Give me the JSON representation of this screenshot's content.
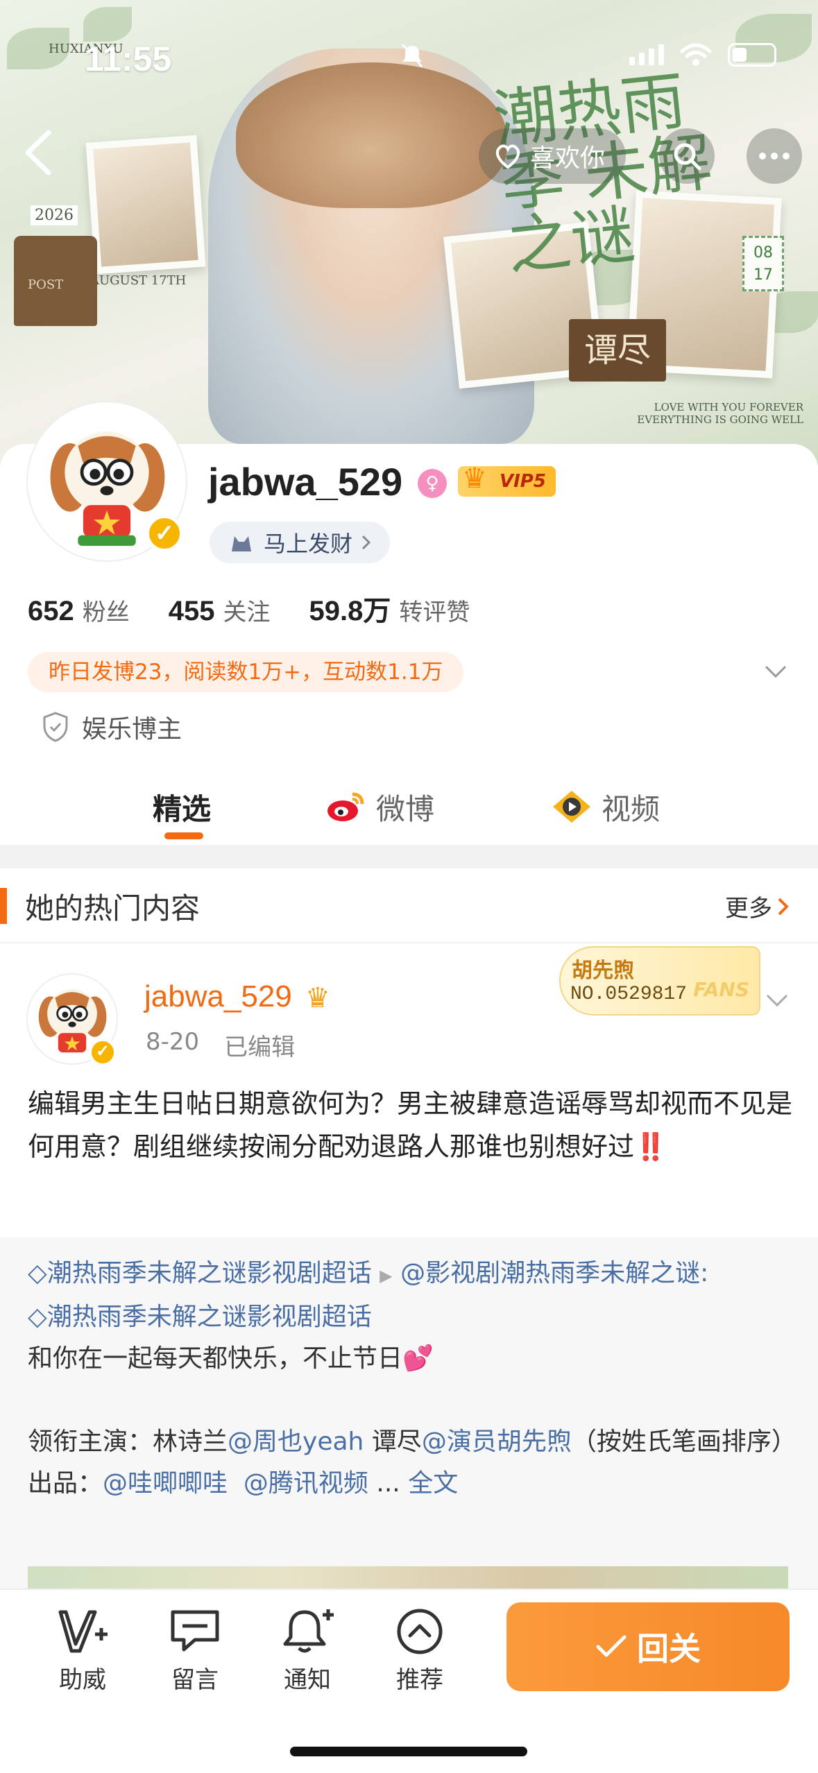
{
  "status_bar": {
    "time": "11:55"
  },
  "cover": {
    "tag_top": "HUXIANXU",
    "tag_year": "2026",
    "tag_date": "AUGUST 17TH",
    "postbox_label": "POST",
    "calligraphy": "潮热雨季 未解之谜",
    "stamp": "08 17",
    "role_badge": "谭尽",
    "tagline": "LOVE WITH YOU FOREVER EVERYTHING IS GOING WELL"
  },
  "nav": {
    "like_label": "喜欢你"
  },
  "profile": {
    "username": "jabwa_529",
    "vip_label": "VIP5",
    "tag_label": "马上发财",
    "stats": [
      {
        "value": "652",
        "label": "粉丝"
      },
      {
        "value": "455",
        "label": "关注"
      },
      {
        "value": "59.8万",
        "label": "转评赞"
      }
    ],
    "yesterday": "昨日发博23，阅读数1万+，互动数1.1万",
    "category": "娱乐博主"
  },
  "tabs": [
    {
      "label": "精选"
    },
    {
      "label": "微博"
    },
    {
      "label": "视频"
    }
  ],
  "hot": {
    "title": "她的热门内容",
    "more": "更多"
  },
  "post": {
    "author": "jabwa_529",
    "date": "8-20",
    "edited": "已编辑",
    "fans_name": "胡先煦",
    "fans_no": "NO.0529817",
    "fans_mark": "FANS",
    "text": "编辑男主生日帖日期意欲何为？男主被肆意造谣辱骂却视而不见是何用意？剧组继续按闹分配劝退路人那谁也别想好过",
    "bang": "‼️"
  },
  "repost": {
    "topic1": "潮热雨季未解之谜影视剧超话",
    "mention1": "@影视剧潮热雨季未解之谜",
    "topic2": "潮热雨季未解之谜影视剧超话",
    "line3": "和你在一起每天都快乐，不止节日",
    "heart": "💕",
    "cast_prefix": "领衔主演：林诗兰",
    "cast_m1": "@周也yeah",
    "cast_mid": " 谭尽",
    "cast_m2": "@演员胡先煦",
    "cast_suffix": "（按姓氏笔画排序）",
    "prod_prefix": "出品：",
    "prod_m1": "@哇唧唧哇",
    "prod_m2": "@腾讯视频",
    "ellipsis": "...",
    "full_text": "全文"
  },
  "bottom_bar": {
    "items": [
      {
        "label": "助威",
        "icon": "v-plus-icon"
      },
      {
        "label": "留言",
        "icon": "chat-icon"
      },
      {
        "label": "通知",
        "icon": "bell-plus-icon"
      },
      {
        "label": "推荐",
        "icon": "chevron-up-circle-icon"
      }
    ],
    "follow_label": "回关"
  },
  "colors": {
    "accent": "#f26a12",
    "link": "#4a6fa5",
    "vip_gold": "#ffb92b"
  }
}
